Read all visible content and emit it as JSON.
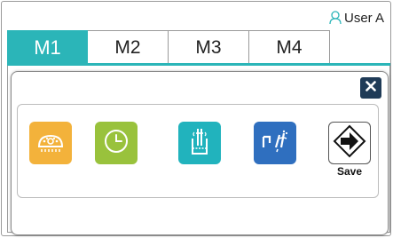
{
  "user": {
    "name": "User A",
    "icon": "user-icon"
  },
  "tabs": [
    {
      "label": "M1",
      "active": true
    },
    {
      "label": "M2",
      "active": false
    },
    {
      "label": "M3",
      "active": false
    },
    {
      "label": "M4",
      "active": false
    }
  ],
  "popup": {
    "close_icon": "close-icon",
    "items": [
      {
        "icon": "lamp-light-icon",
        "color": "#f3b23b"
      },
      {
        "icon": "clock-timer-icon",
        "color": "#99c23c"
      },
      {
        "icon": "instrument-cup-icon",
        "color": "#21b3bd"
      },
      {
        "icon": "handpiece-spray-icon",
        "color": "#2f6fbf"
      }
    ],
    "save": {
      "label": "Save",
      "icon": "save-arrow-icon"
    }
  },
  "colors": {
    "accent": "#2bb5b8",
    "close_bg": "#1f3b57"
  }
}
